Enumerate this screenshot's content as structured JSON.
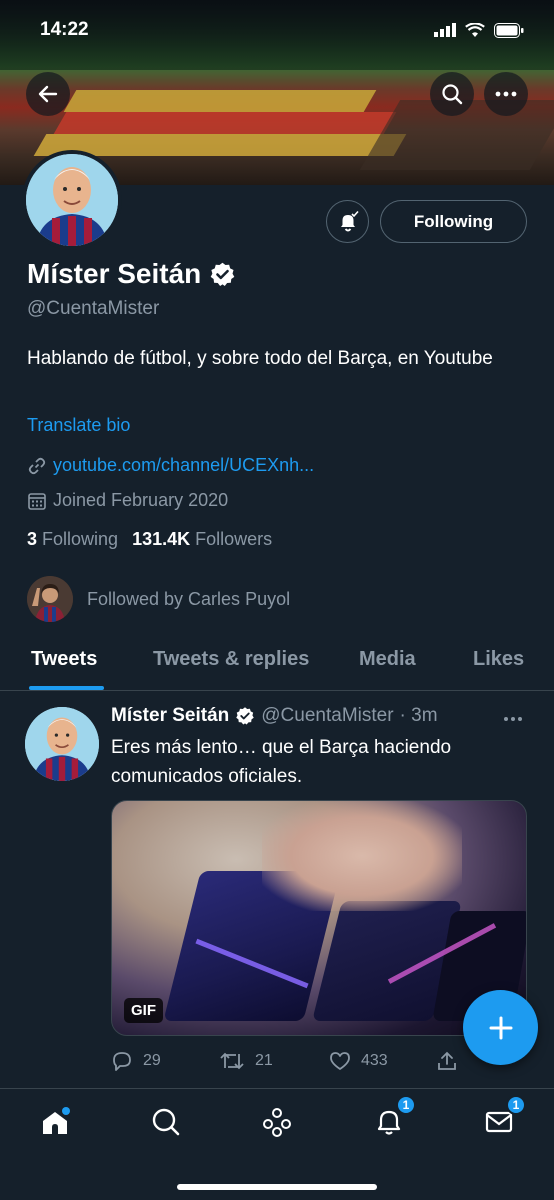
{
  "status_bar": {
    "time": "14:22"
  },
  "profile": {
    "name": "Míster Seitán",
    "handle": "@CuentaMister",
    "bio": "Hablando de fútbol, y sobre todo del Barça, en Youtube",
    "translate_label": "Translate bio",
    "website": "youtube.com/channel/UCEXnh...",
    "joined": "Joined February 2020",
    "following_count": "3",
    "following_label": "Following",
    "followers_count": "131.4K",
    "followers_label": "Followers",
    "followed_by": "Followed by Carles Puyol",
    "following_button": "Following"
  },
  "tabs": [
    {
      "label": "Tweets",
      "active": true
    },
    {
      "label": "Tweets & replies",
      "active": false
    },
    {
      "label": "Media",
      "active": false
    },
    {
      "label": "Likes",
      "active": false
    }
  ],
  "tweet": {
    "name": "Míster Seitán",
    "handle": "@CuentaMister",
    "time": "· 3m",
    "text": "Eres más lento… que el Barça haciendo comunicados oficiales.",
    "media_badge": "GIF",
    "replies": "29",
    "retweets": "21",
    "likes": "433"
  },
  "nav": {
    "notifications_badge": "1",
    "messages_badge": "1"
  },
  "colors": {
    "background": "#15202b",
    "accent": "#1d9bf0",
    "secondary_text": "#8b98a5",
    "border": "#38444d"
  },
  "icons": [
    "back-arrow-icon",
    "search-icon",
    "more-icon",
    "bell-icon",
    "verified-icon",
    "link-icon",
    "calendar-icon",
    "reply-icon",
    "retweet-icon",
    "like-icon",
    "share-icon",
    "compose-icon",
    "home-icon",
    "explore-icon",
    "spaces-icon",
    "notifications-icon",
    "messages-icon"
  ]
}
